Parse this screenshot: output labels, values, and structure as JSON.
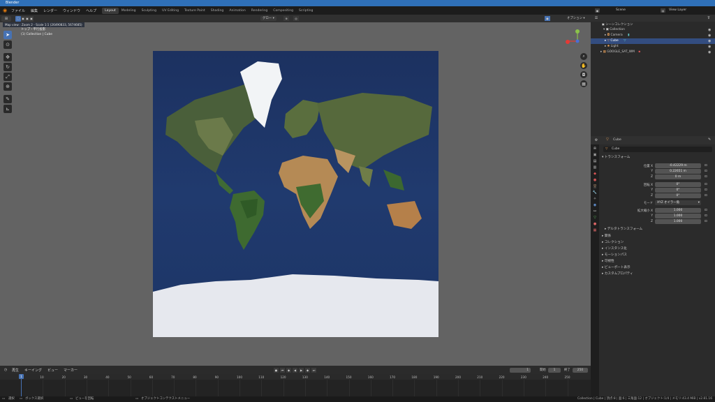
{
  "window": {
    "title": "Blender"
  },
  "menubar": {
    "menus": [
      "ファイル",
      "編集",
      "レンダー",
      "ウィンドウ",
      "ヘルプ"
    ],
    "workspaces": [
      "Layout",
      "Modeling",
      "Sculpting",
      "UV Editing",
      "Texture Paint",
      "Shading",
      "Animation",
      "Rendering",
      "Compositing",
      "Scripting"
    ],
    "active_workspace": "Layout",
    "scene_label": "Scene",
    "view_layer_label": "View Layer"
  },
  "viewport": {
    "header_mode": "グロー",
    "options_label": "オプション",
    "overlay_line1": "Map view : Zoom 2 - Scale 1:1 (26490833, 5674685)",
    "overlay_line2": "トップ・平行投影",
    "overlay_line3": "(1) Collection | Cube"
  },
  "outliner": {
    "header": "シーンコレクション",
    "items": [
      {
        "name": "Collection"
      },
      {
        "name": "Camera"
      },
      {
        "name": "Cube"
      },
      {
        "name": "Light"
      },
      {
        "name": "GOOGLE_SAT_WM"
      }
    ]
  },
  "properties": {
    "object_name": "Cube",
    "data_name": "Cube",
    "transform_header": "トランスフォーム",
    "location_label": "位置 X",
    "location": [
      "-0.42229 m",
      "0.22651 m",
      "0 m"
    ],
    "rotation_label": "回転 X",
    "rotation": [
      "0°",
      "0°",
      "0°"
    ],
    "axis_y": "Y",
    "axis_z": "Z",
    "mode_label": "モード",
    "mode_value": "XYZ オイラー角",
    "scale_label": "拡大縮小 X",
    "scale": [
      "1.000",
      "1.000",
      "1.000"
    ],
    "delta_transform": "デルタトランスフォーム",
    "sections": [
      "関係",
      "コレクション",
      "インスタンス化",
      "モーションパス",
      "可視性",
      "ビューポート表示",
      "カスタムプロパティ"
    ]
  },
  "timeline": {
    "menus": [
      "再生",
      "キーイング",
      "ビュー",
      "マーカー"
    ],
    "current_frame": "1",
    "start_label": "開始",
    "start_value": "1",
    "end_label": "終了",
    "end_value": "250",
    "ticks": [
      "0",
      "10",
      "20",
      "30",
      "40",
      "50",
      "60",
      "70",
      "80",
      "90",
      "100",
      "110",
      "120",
      "130",
      "140",
      "150",
      "160",
      "170",
      "180",
      "190",
      "200",
      "210",
      "220",
      "230",
      "240",
      "250"
    ],
    "frame_indicator": "1"
  },
  "statusbar": {
    "select": "選択",
    "box_select": "ボックス選択",
    "rotate_view": "ビューを回転",
    "context_menu": "オブジェクトコンテクストメニュー",
    "stats": "Collection | Cube | 頂点:8 | 面:6 | 三角面:12 | オブジェクト:1/4 | メモリ:43.4 MiB | v2.81.16"
  },
  "colors": {
    "accent": "#4772b3",
    "titlebar": "#2f70b8",
    "viewport_bg": "#636363"
  }
}
